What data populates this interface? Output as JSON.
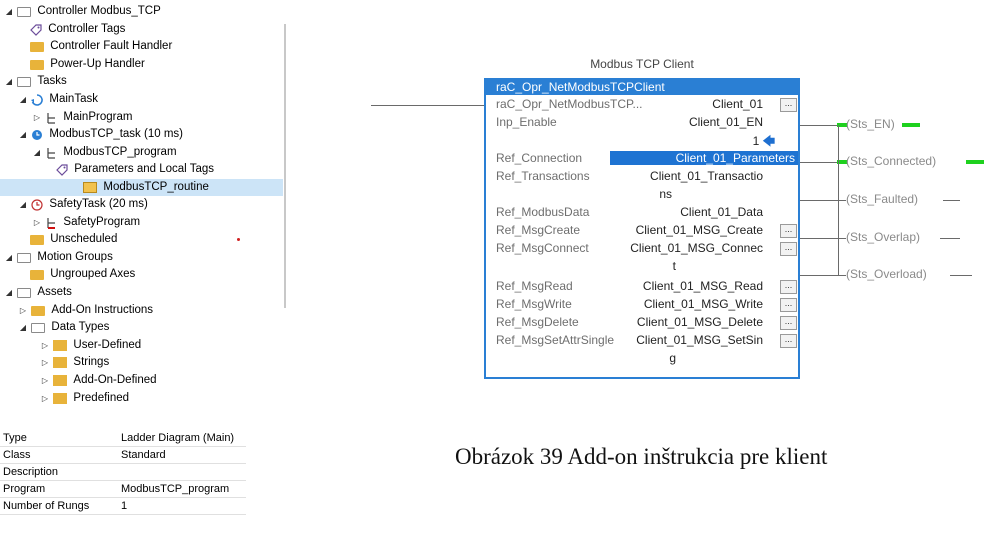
{
  "tree": {
    "items": [
      {
        "label": "Controller Modbus_TCP"
      },
      {
        "label": "Controller Tags"
      },
      {
        "label": "Controller Fault Handler"
      },
      {
        "label": "Power-Up Handler"
      },
      {
        "label": "Tasks"
      },
      {
        "label": "MainTask"
      },
      {
        "label": "MainProgram"
      },
      {
        "label": "ModbusTCP_task (10 ms)"
      },
      {
        "label": "ModbusTCP_program"
      },
      {
        "label": "Parameters and Local Tags"
      },
      {
        "label": "ModbusTCP_routine"
      },
      {
        "label": "SafetyTask (20 ms)"
      },
      {
        "label": "SafetyProgram"
      },
      {
        "label": "Unscheduled"
      },
      {
        "label": "Motion Groups"
      },
      {
        "label": "Ungrouped Axes"
      },
      {
        "label": "Assets"
      },
      {
        "label": "Add-On Instructions"
      },
      {
        "label": "Data Types"
      },
      {
        "label": "User-Defined"
      },
      {
        "label": "Strings"
      },
      {
        "label": "Add-On-Defined"
      },
      {
        "label": "Predefined"
      }
    ]
  },
  "properties": [
    {
      "key": "Type",
      "value": "Ladder Diagram (Main)"
    },
    {
      "key": "Class",
      "value": "Standard"
    },
    {
      "key": "Description",
      "value": ""
    },
    {
      "key": "Program",
      "value": "ModbusTCP_program"
    },
    {
      "key": "Number of Rungs",
      "value": "1"
    }
  ],
  "block": {
    "title": "Modbus TCP Client",
    "name": "raC_Opr_NetModbusTCPClient",
    "params": [
      {
        "name": "raC_Opr_NetModbusTCP...",
        "value": "Client_01"
      },
      {
        "name": "Inp_Enable",
        "value": "Client_01_EN"
      },
      {
        "name": "",
        "value": "1"
      },
      {
        "name": "Ref_Connection",
        "value": "Client_01_Parameters"
      },
      {
        "name": "Ref_Transactions",
        "value": "Client_01_Transactio"
      },
      {
        "name": "",
        "value": "ns"
      },
      {
        "name": "Ref_ModbusData",
        "value": "Client_01_Data"
      },
      {
        "name": "Ref_MsgCreate",
        "value": "Client_01_MSG_Create"
      },
      {
        "name": "Ref_MsgConnect",
        "value": "Client_01_MSG_Connec"
      },
      {
        "name": "",
        "value": "t"
      },
      {
        "name": "Ref_MsgRead",
        "value": "Client_01_MSG_Read"
      },
      {
        "name": "Ref_MsgWrite",
        "value": "Client_01_MSG_Write"
      },
      {
        "name": "Ref_MsgDelete",
        "value": "Client_01_MSG_Delete"
      },
      {
        "name": "Ref_MsgSetAttrSingle",
        "value": "Client_01_MSG_SetSin"
      },
      {
        "name": "",
        "value": "g"
      }
    ],
    "ellipsis": "...",
    "arrow": "🡄"
  },
  "outputs": [
    {
      "label": "Sts_EN"
    },
    {
      "label": "Sts_Connected"
    },
    {
      "label": "Sts_Faulted"
    },
    {
      "label": "Sts_Overlap"
    },
    {
      "label": "Sts_Overload"
    }
  ],
  "caption": "Obrázok 39 Add-on inštrukcia pre klient",
  "colors": {
    "accent": "#2a7fd4",
    "energized": "#1ed11e",
    "selection": "#cce4f7"
  }
}
